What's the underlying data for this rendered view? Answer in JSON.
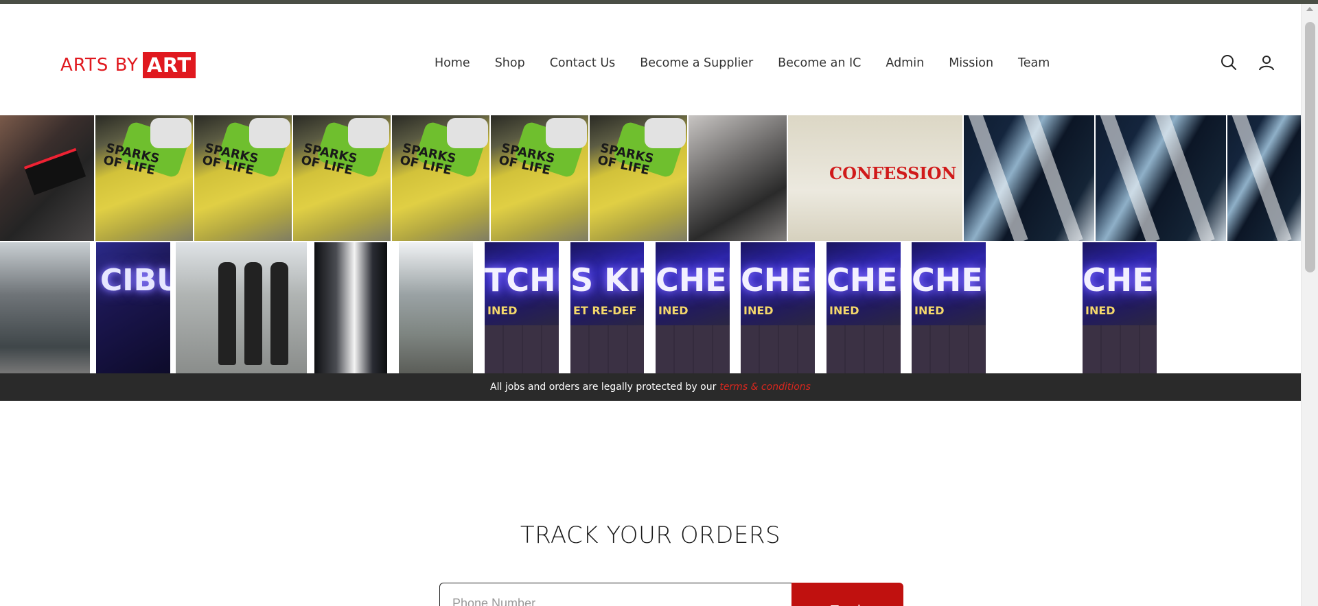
{
  "brand": {
    "name_plain": "ARTS BY",
    "name_boxed": "ART",
    "accent_color": "#e0191f"
  },
  "nav": {
    "items": [
      {
        "label": "Home"
      },
      {
        "label": "Shop"
      },
      {
        "label": "Contact Us"
      },
      {
        "label": "Become a Supplier"
      },
      {
        "label": "Become an IC"
      },
      {
        "label": "Admin"
      },
      {
        "label": "Mission"
      },
      {
        "label": "Team"
      }
    ]
  },
  "header_icons": {
    "search": "search-icon",
    "account": "account-icon"
  },
  "banner": {
    "row1": [
      {
        "type": "cap-photo"
      },
      {
        "type": "shirt-photo",
        "print": "SPARKS OF LIFE"
      },
      {
        "type": "shirt-photo",
        "print": "SPARKS OF LIFE"
      },
      {
        "type": "shirt-photo",
        "print": "SPARKS OF LIFE"
      },
      {
        "type": "shirt-photo",
        "print": "SPARKS OF LIFE"
      },
      {
        "type": "shirt-photo",
        "print": "SPARKS OF LIFE"
      },
      {
        "type": "shirt-photo",
        "print": "SPARKS OF LIFE"
      },
      {
        "type": "caps-photo"
      },
      {
        "type": "tee-photo",
        "print": "CONFESSION"
      },
      {
        "type": "banner-photo"
      },
      {
        "type": "banner-photo"
      },
      {
        "type": "banner-photo"
      }
    ],
    "row2": [
      {
        "type": "street-photo"
      },
      {
        "type": "neon-photo",
        "text": "CIBU"
      },
      {
        "type": "people-photo"
      },
      {
        "type": "light-photo"
      },
      {
        "type": "road-photo"
      },
      {
        "type": "kitchen-photo",
        "text": "TCHE",
        "sub": "INED"
      },
      {
        "type": "kitchen-photo",
        "text": "S KITC",
        "sub": "ET RE-DEF"
      },
      {
        "type": "kitchen-photo",
        "text": "CHEN",
        "sub": "INED"
      },
      {
        "type": "kitchen-photo",
        "text": "CHEN",
        "sub": "INED"
      },
      {
        "type": "kitchen-photo",
        "text": "CHEN",
        "sub": "INED"
      },
      {
        "type": "kitchen-photo",
        "text": "CHEN",
        "sub": "INED"
      },
      {
        "type": "blank"
      },
      {
        "type": "kitchen-photo",
        "text": "CHEN",
        "sub": "INED"
      }
    ]
  },
  "terms": {
    "text": "All jobs and orders are legally protected by our",
    "link": "terms & conditions",
    "link_color": "#d9271e"
  },
  "track": {
    "title": "TRACK YOUR ORDERS",
    "input_placeholder": "Phone Number",
    "button_label": "Track",
    "button_color": "#c0110f"
  }
}
